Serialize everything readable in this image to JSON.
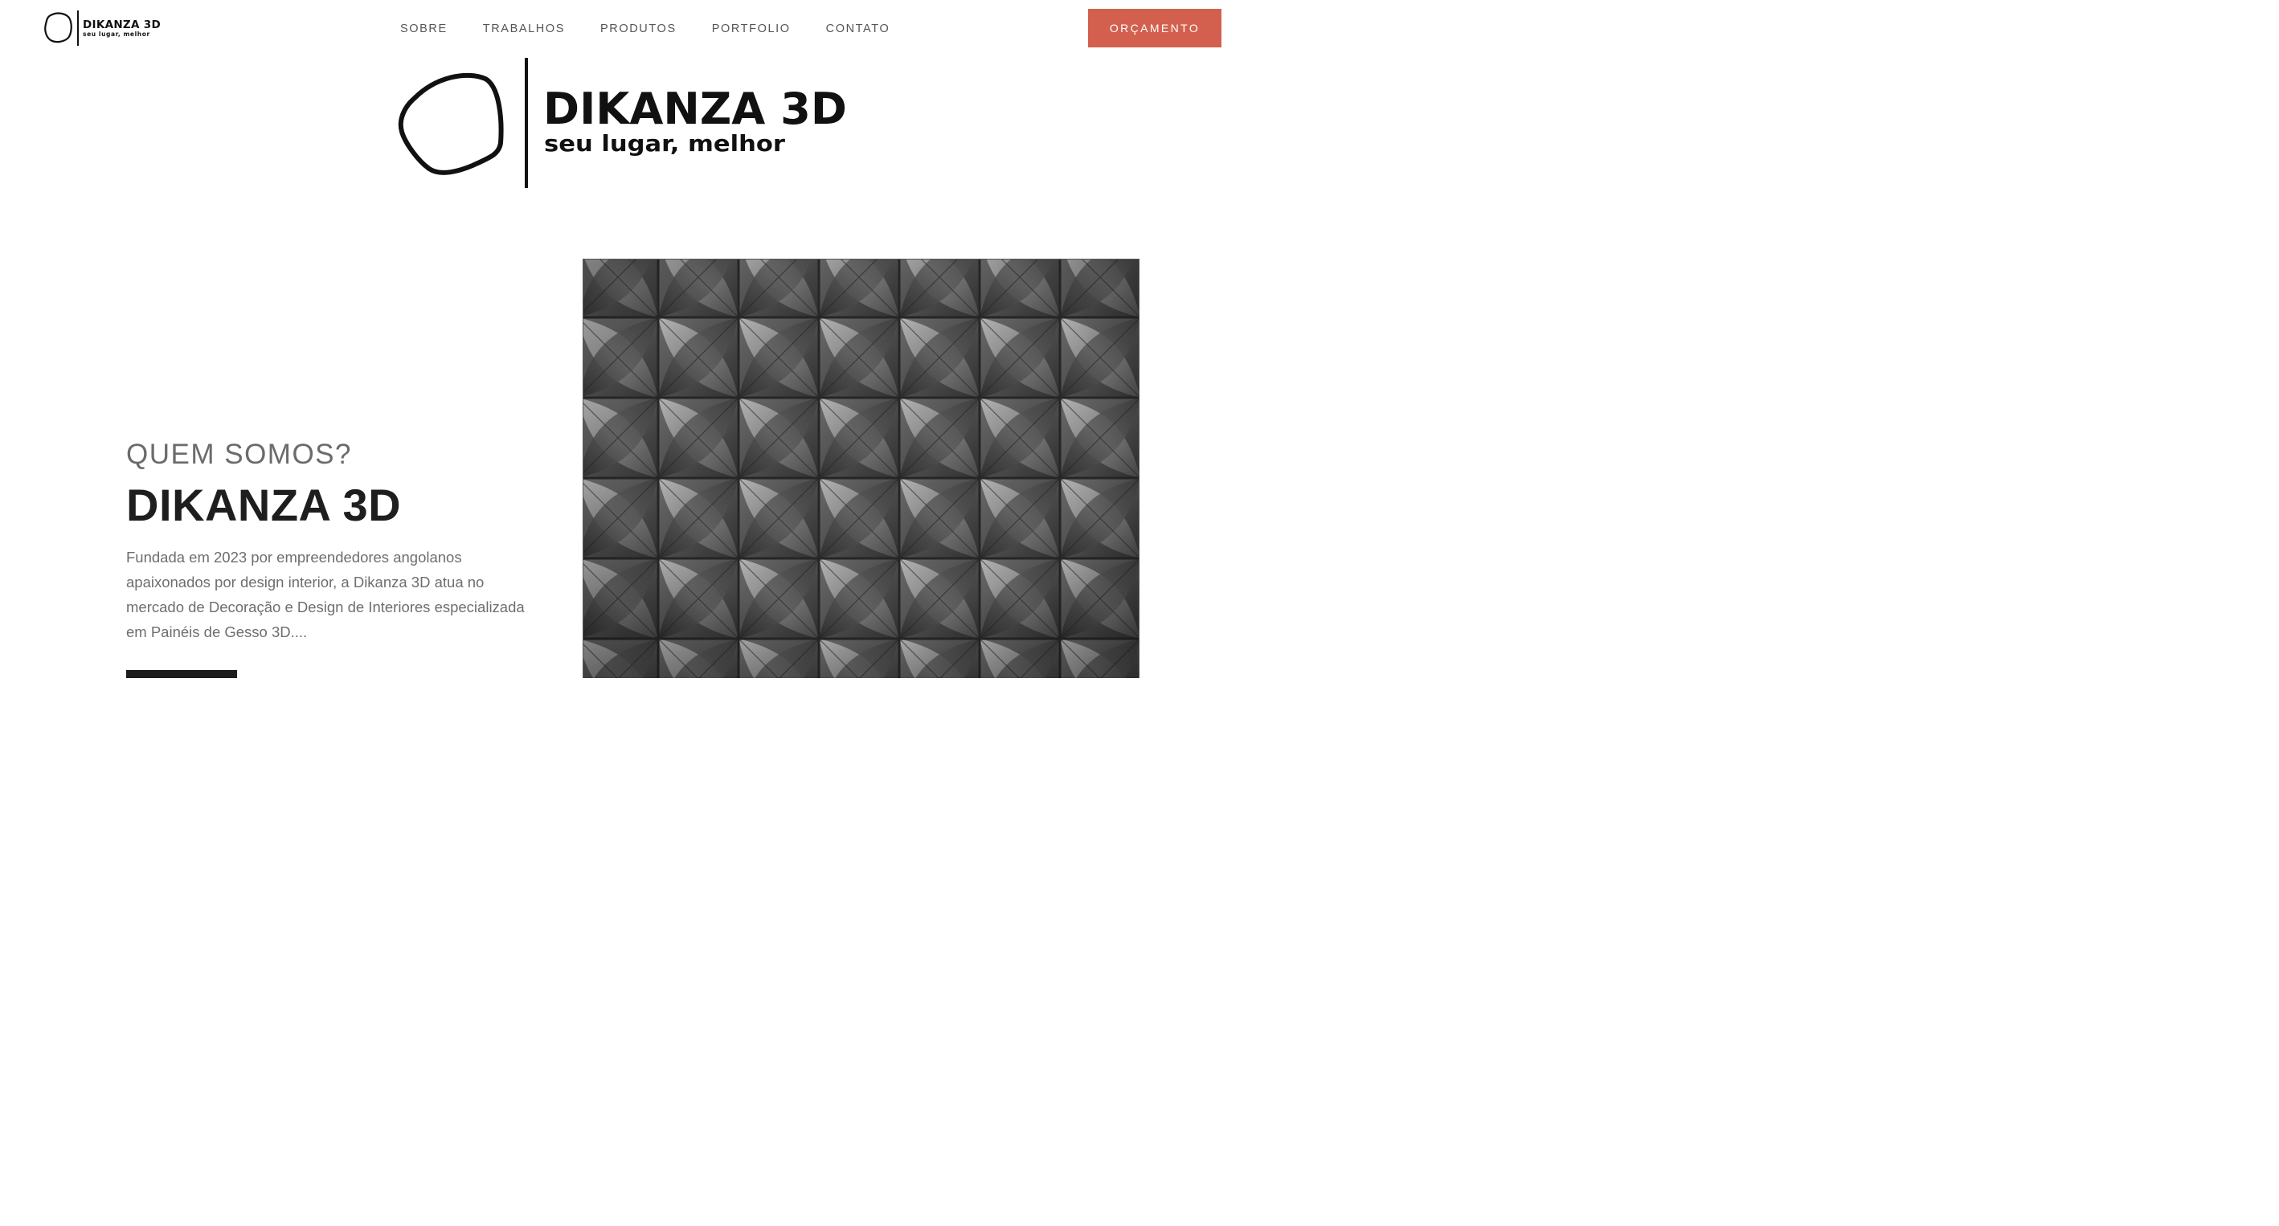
{
  "brand": {
    "name": "DIKANZA 3D",
    "tagline": "seu lugar, melhor"
  },
  "nav": {
    "items": [
      {
        "label": "SOBRE"
      },
      {
        "label": "TRABALHOS"
      },
      {
        "label": "PRODUTOS"
      },
      {
        "label": "PORTFOLIO"
      },
      {
        "label": "CONTATO"
      }
    ]
  },
  "header": {
    "cta_label": "ORÇAMENTO"
  },
  "about": {
    "kicker": "QUEM SOMOS?",
    "title": "DIKANZA 3D",
    "text": "Fundada em 2023 por empreendedores angolanos apaixonados por design interior, a Dikanza 3D atua no mercado de Decoração e Design de Interiores especializada em Painéis de Gesso 3D...."
  },
  "colors": {
    "accent": "#d3604f",
    "dark": "#1e1e1e",
    "muted_text": "#6e6e6e"
  }
}
